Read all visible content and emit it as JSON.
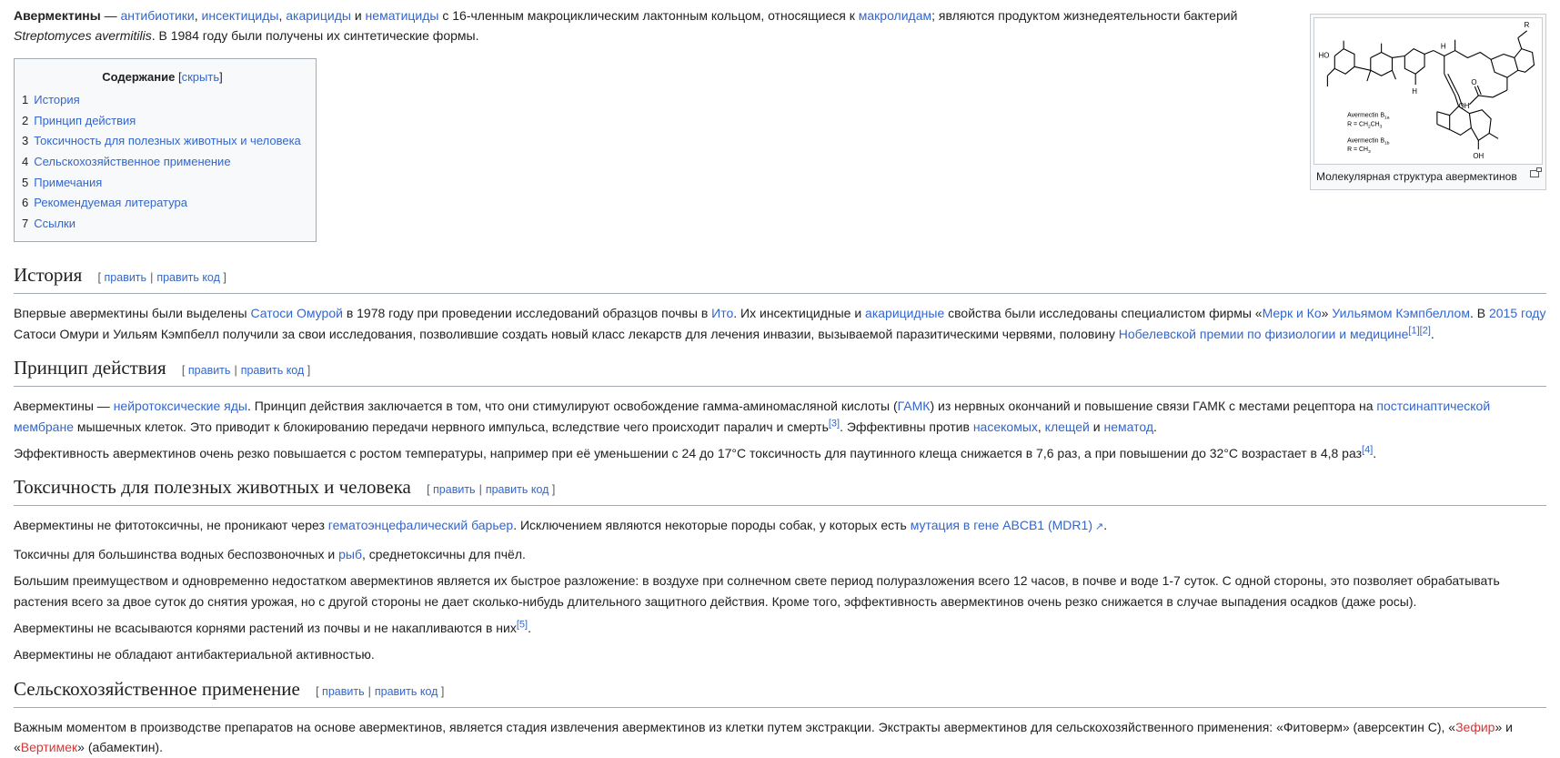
{
  "intro": {
    "bold_term": "Авермектины",
    "dash": " — ",
    "link_antibiotics": "антибиотики",
    "link_insecticides": "инсектициды",
    "link_acaricides": "акарициды",
    "and": "и",
    "link_nematicides": "нематициды",
    "text_1": "с 16-членным макроциклическим лактонным кольцом, относящиеся к",
    "link_macrolides": "макролидам",
    "text_2": "; являются продуктом жизнедеятельности бактерий",
    "species": "Streptomyces avermitilis",
    "text_3": ". В 1984 году были получены их синтетические формы."
  },
  "infobox": {
    "caption": "Молекулярная структура авермектинов",
    "molecule_labels": {
      "r": "R",
      "ho": "HO",
      "h": "H",
      "oh": "OH",
      "o": "O",
      "b1a": "Avermectin B",
      "b1a_sub": "1a",
      "b1a_r": "R = CH",
      "b1a_r_sub": "2",
      "b1a_r_tail": "CH",
      "b1a_r_tail_sub": "3",
      "b1b": "Avermectin B",
      "b1b_sub": "1b",
      "b1b_r": "R = CH",
      "b1b_r_sub": "3"
    }
  },
  "toc": {
    "title": "Содержание",
    "toggle_open": "[",
    "toggle": "скрыть",
    "toggle_close": "]",
    "items": [
      {
        "num": "1",
        "label": "История"
      },
      {
        "num": "2",
        "label": "Принцип действия"
      },
      {
        "num": "3",
        "label": "Токсичность для полезных животных и человека"
      },
      {
        "num": "4",
        "label": "Сельскохозяйственное применение"
      },
      {
        "num": "5",
        "label": "Примечания"
      },
      {
        "num": "6",
        "label": "Рекомендуемая литература"
      },
      {
        "num": "7",
        "label": "Ссылки"
      }
    ]
  },
  "edit": {
    "open": "[",
    "edit": "править",
    "sep": "|",
    "edit_code": "править код",
    "close": "]"
  },
  "history": {
    "heading": "История",
    "p1_a": "Впервые авермектины были выделены",
    "l_omura": "Сатоси Омурой",
    "p1_b": "в 1978 году при проведении исследований образцов почвы в",
    "l_ito": "Ито",
    "p1_c": ". Их инсектицидные и",
    "l_acaricide": "акарицидные",
    "p1_d": "свойства были исследованы специалистом фирмы «",
    "l_merck": "Мерк и Ко",
    "p1_e": "»",
    "l_campbell": "Уильямом Кэмпбеллом",
    "p1_f": ". В",
    "l_2015": "2015 году",
    "p1_g": "Сатоси Омури и Уильям Кэмпбелл получили за свои исследования, позволившие создать новый класс лекарств для лечения инвазии, вызываемой паразитическими червями, половину",
    "l_nobel": "Нобелевской премии по физиологии и медицине",
    "ref1": "[1]",
    "ref2": "[2]",
    "end": "."
  },
  "mechanism": {
    "heading": "Принцип действия",
    "p1_a": "Авермектины —",
    "l_neuro": "нейротоксические яды",
    "p1_b": ". Принцип действия заключается в том, что они стимулируют освобождение гамма-аминомасляной кислоты (",
    "l_gaba": "ГАМК",
    "p1_c": ") из нервных окончаний и повышение связи ГАМК с местами рецептора на",
    "l_membrane": "постсинаптической мембране",
    "p1_d": "мышечных клеток. Это приводит к блокированию передачи нервного импульса, вследствие чего происходит паралич и смерть",
    "ref3": "[3]",
    "p1_e": ". Эффективны против",
    "l_insects": "насекомых",
    "comma": ",",
    "l_mites": "клещей",
    "and": "и",
    "l_nematodes": "нематод",
    "end": ".",
    "p2": "Эффективность авермектинов очень резко повышается с ростом температуры, например при её уменьшении с 24 до 17°C токсичность для паутинного клеща снижается в 7,6 раз, а при повышении до 32°C возрастает в 4,8 раз",
    "ref4": "[4]",
    "p2_end": "."
  },
  "toxicity": {
    "heading": "Токсичность для полезных животных и человека",
    "p1_a": "Авермектины не фитотоксичны, не проникают через",
    "l_bbb": "гематоэнцефалический барьер",
    "p1_b": ". Исключением являются некоторые породы собак, у которых есть",
    "l_mdr1": "мутация в гене ABCB1 (MDR1)",
    "end": ".",
    "p2_a": "Токсичны для большинства водных беспозвоночных и",
    "l_fish": "рыб",
    "p2_b": ", среднетоксичны для пчёл.",
    "p3": "Большим преимуществом и одновременно недостатком авермектинов является их быстрое разложение: в воздухе при солнечном свете период полуразложения всего 12 часов, в почве и воде 1-7 суток. С одной стороны, это позволяет обрабатывать растения всего за двое суток до снятия урожая, но с другой стороны не дает сколько-нибудь длительного защитного действия. Кроме того, эффективность авермектинов очень резко снижается в случае выпадения осадков (даже росы).",
    "p4": "Авермектины не всасываются корнями растений из почвы и не накапливаются в них",
    "ref5": "[5]",
    "p5": "Авермектины не обладают антибактериальной активностью."
  },
  "agri": {
    "heading": "Сельскохозяйственное применение",
    "p1_a": "Важным моментом в производстве препаратов на основе авермектинов, является стадия извлечения авермектинов из клетки путем экстракции. Экстракты авермектинов для сельскохозяйственного применения: «Фитоверм» (аверсектин С), «",
    "l_zefir": "Зефир",
    "p1_b": "» и «",
    "l_vertimek": "Вертимек",
    "p1_c": "» (абамектин)."
  }
}
